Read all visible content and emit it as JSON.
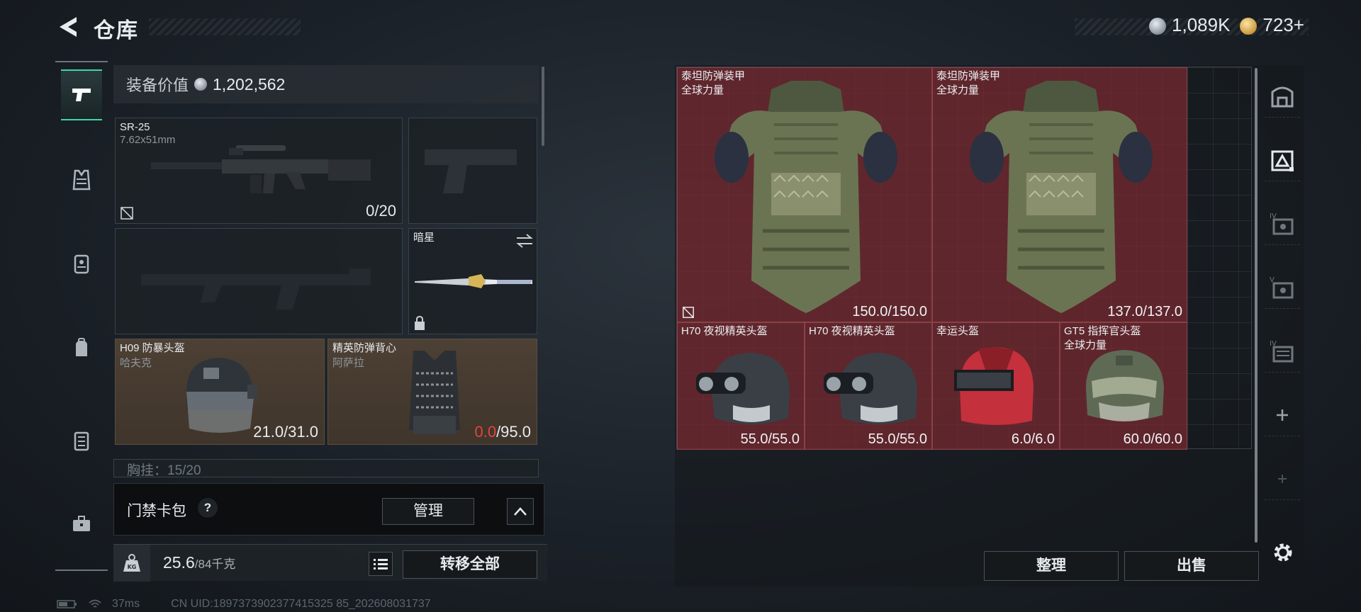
{
  "header": {
    "title": "仓库",
    "currency": [
      {
        "icon": "silver-coin-icon",
        "value": "1,089K"
      },
      {
        "icon": "gold-coin-icon",
        "value": "723+"
      }
    ]
  },
  "left_nav": [
    {
      "name": "weapons",
      "icon": "pistol-icon",
      "active": true
    },
    {
      "name": "armor",
      "icon": "vest-icon",
      "active": false
    },
    {
      "name": "chest-rig",
      "icon": "chest-rig-icon",
      "active": false
    },
    {
      "name": "backpack",
      "icon": "backpack-icon",
      "active": false
    },
    {
      "name": "container",
      "icon": "case-icon",
      "active": false
    },
    {
      "name": "toolbox",
      "icon": "toolbox-icon",
      "active": false
    }
  ],
  "equipment": {
    "value_label": "装备价值",
    "value": "1,202,562",
    "primary_weapon": {
      "name": "SR-25",
      "caliber": "7.62x51mm",
      "ammo": "0/20"
    },
    "melee": {
      "name": "暗星"
    },
    "helmet": {
      "name": "H09 防暴头盔",
      "sub": "哈夫克",
      "durability": "21.0/31.0"
    },
    "armor": {
      "name": "精英防弹背心",
      "sub": "阿萨拉",
      "durability_current": "0.0",
      "durability_max": "/95.0"
    },
    "chest_rig_partial": "胸挂：15/20",
    "keycard_label": "门禁卡包",
    "keycard_help": "?",
    "manage_label": "管理",
    "weight_current": "25.6",
    "weight_max": "/84千克",
    "weight_badge": "KG",
    "transfer_all_label": "转移全部"
  },
  "stash": {
    "items": [
      {
        "name": "泰坦防弹装甲",
        "sub": "全球力量",
        "durability": "150.0/150.0",
        "type": "armor"
      },
      {
        "name": "泰坦防弹装甲",
        "sub": "全球力量",
        "durability": "137.0/137.0",
        "type": "armor"
      },
      {
        "name": "H70 夜视精英头盔",
        "sub": "",
        "durability": "55.0/55.0",
        "type": "nv-helmet"
      },
      {
        "name": "H70 夜视精英头盔",
        "sub": "",
        "durability": "55.0/55.0",
        "type": "nv-helmet"
      },
      {
        "name": "幸运头盔",
        "sub": "",
        "durability": "6.0/6.0",
        "type": "red-helmet"
      },
      {
        "name": "GT5 指挥官头盔",
        "sub": "全球力量",
        "durability": "60.0/60.0",
        "type": "commander-helmet"
      }
    ],
    "sort_label": "整理",
    "sell_label": "出售"
  },
  "right_nav": [
    {
      "name": "stash-main",
      "icon": "stash-icon"
    },
    {
      "name": "stash-page-1",
      "icon": "stash-tab-icon"
    },
    {
      "name": "stash-page-iv",
      "icon": "stash-tab-iv-icon"
    },
    {
      "name": "stash-page-v",
      "icon": "stash-tab-v-icon"
    },
    {
      "name": "stash-page-iv-2",
      "icon": "stash-tab-iv-2-icon"
    },
    {
      "name": "add-page",
      "icon": "plus-icon"
    },
    {
      "name": "add-page-locked",
      "icon": "plus-icon"
    },
    {
      "name": "settings",
      "icon": "gear-icon"
    }
  ],
  "status": {
    "ping": "37ms",
    "uid": "CN UID:1897373902377415325 85_202608031737"
  },
  "colors": {
    "accent": "#3fd6a8",
    "item_bg": "#7a2a30",
    "slot_brown": "#4d4034",
    "warning_red": "#e0453a"
  }
}
